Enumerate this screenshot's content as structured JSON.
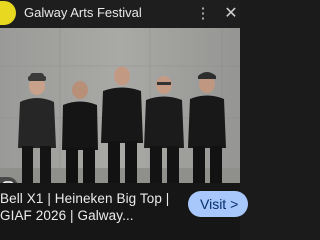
{
  "header": {
    "site_name": "Galway Arts Festival",
    "favicon_icon": "site-favicon",
    "menu_icon": "more-vert",
    "close_icon": "close"
  },
  "image": {
    "subject": "five-men-standing-against-concrete-wall",
    "lens_icon": "google-lens"
  },
  "result": {
    "title_line1": "Bell X1 | Heineken Big Top |",
    "title_line2": "GIAF 2026 | Galway...",
    "visit_label": "Visit >"
  },
  "colors": {
    "favicon": "#e8d81f",
    "visit_bg": "#a8c7fa",
    "visit_text": "#062e6f"
  }
}
